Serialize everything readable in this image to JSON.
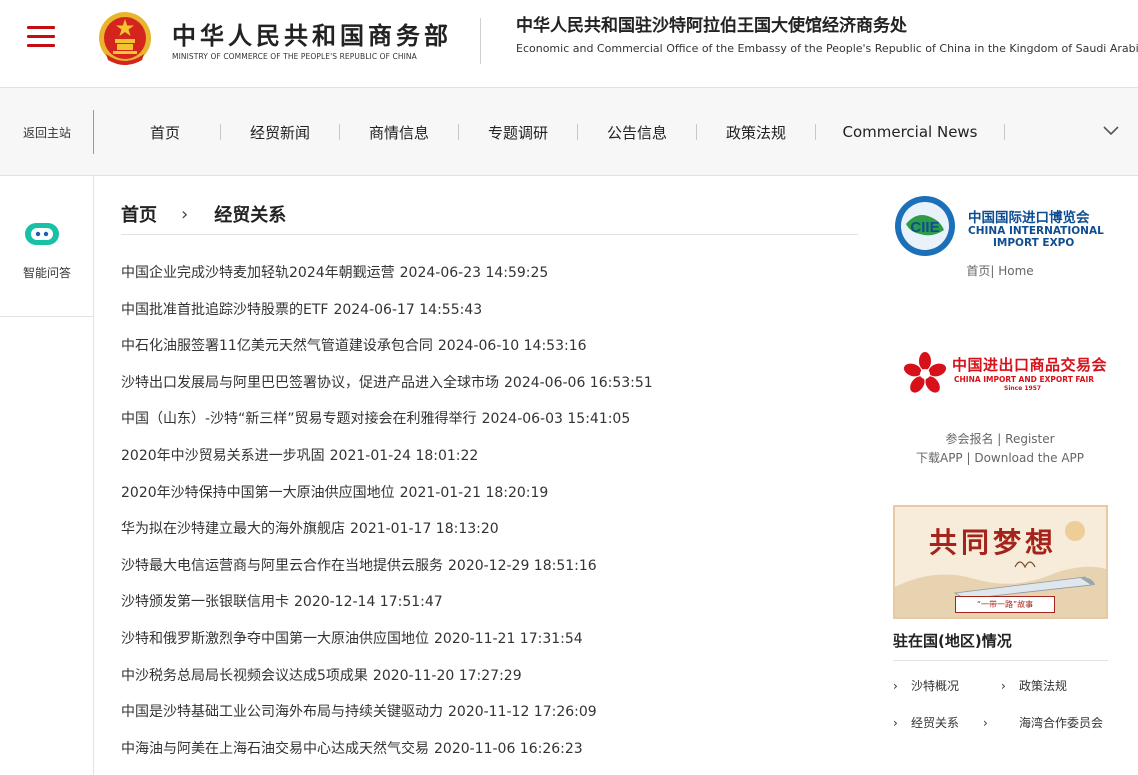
{
  "header": {
    "ministry_cn": "中华人民共和国商务部",
    "ministry_en": "MINISTRY OF COMMERCE OF THE PEOPLE'S REPUBLIC OF CHINA",
    "office_cn": "中华人民共和国驻沙特阿拉伯王国大使馆经济商务处",
    "office_en": "Economic and Commercial Office of the Embassy of the People's Republic of China in the Kingdom of Saudi Arabia"
  },
  "nav": {
    "back_home": "返回主站",
    "items": [
      "首页",
      "经贸新闻",
      "商情信息",
      "专题调研",
      "公告信息",
      "政策法规",
      "Commercial News"
    ]
  },
  "left_rail": {
    "ai_label": "智能问答"
  },
  "breadcrumb": {
    "home": "首页",
    "separator": "›",
    "current": "经贸关系"
  },
  "news": [
    {
      "title": "中国企业完成沙特麦加轻轨2024年朝觐运营",
      "date": "2024-06-23 14:59:25"
    },
    {
      "title": "中国批准首批追踪沙特股票的ETF",
      "date": "2024-06-17 14:55:43"
    },
    {
      "title": "中石化油服签署11亿美元天然气管道建设承包合同",
      "date": "2024-06-10 14:53:16"
    },
    {
      "title": "沙特出口发展局与阿里巴巴签署协议，促进产品进入全球市场",
      "date": "2024-06-06 16:53:51"
    },
    {
      "title": "中国（山东）-沙特“新三样”贸易专题对接会在利雅得举行",
      "date": "2024-06-03 15:41:05"
    },
    {
      "title": "2020年中沙贸易关系进一步巩固",
      "date": "2021-01-24 18:01:22"
    },
    {
      "title": "2020年沙特保持中国第一大原油供应国地位",
      "date": "2021-01-21 18:20:19"
    },
    {
      "title": "华为拟在沙特建立最大的海外旗舰店",
      "date": "2021-01-17 18:13:20"
    },
    {
      "title": "沙特最大电信运营商与阿里云合作在当地提供云服务",
      "date": "2020-12-29 18:51:16"
    },
    {
      "title": "沙特颁发第一张银联信用卡",
      "date": "2020-12-14 17:51:47"
    },
    {
      "title": "沙特和俄罗斯激烈争夺中国第一大原油供应国地位",
      "date": "2020-11-21 17:31:54"
    },
    {
      "title": "中沙税务总局局长视频会议达成5项成果",
      "date": "2020-11-20 17:27:29"
    },
    {
      "title": "中国是沙特基础工业公司海外布局与持续关键驱动力",
      "date": "2020-11-12 17:26:09"
    },
    {
      "title": "中海油与阿美在上海石油交易中心达成天然气交易",
      "date": "2020-11-06 16:26:23"
    }
  ],
  "sidebar": {
    "ciie": {
      "badge": "CIIE",
      "name_cn": "中国国际进口博览会",
      "name_en_1": "CHINA INTERNATIONAL",
      "name_en_2": "IMPORT EXPO",
      "link_cn": "首页",
      "link_sep": "|",
      "link_en": " Home"
    },
    "canton": {
      "name_cn": "中国进出口商品交易会",
      "name_en": "CHINA IMPORT AND EXPORT FAIR",
      "since": "Since 1957",
      "register_cn": "参会报名",
      "register_en": " Register",
      "app_cn": "下载APP",
      "app_en": " Download the APP",
      "sep": " | "
    },
    "dream": {
      "title": "共同梦想",
      "caption": "“一带一路”故事"
    },
    "country": {
      "title": "驻在国(地区)情况",
      "items": [
        "沙特概况",
        "政策法规",
        "经贸关系",
        "海湾合作委员会"
      ]
    }
  },
  "colors": {
    "accent_red": "#c40d12",
    "ciie_blue": "#0e4d92",
    "canton_red": "#d6111a"
  }
}
